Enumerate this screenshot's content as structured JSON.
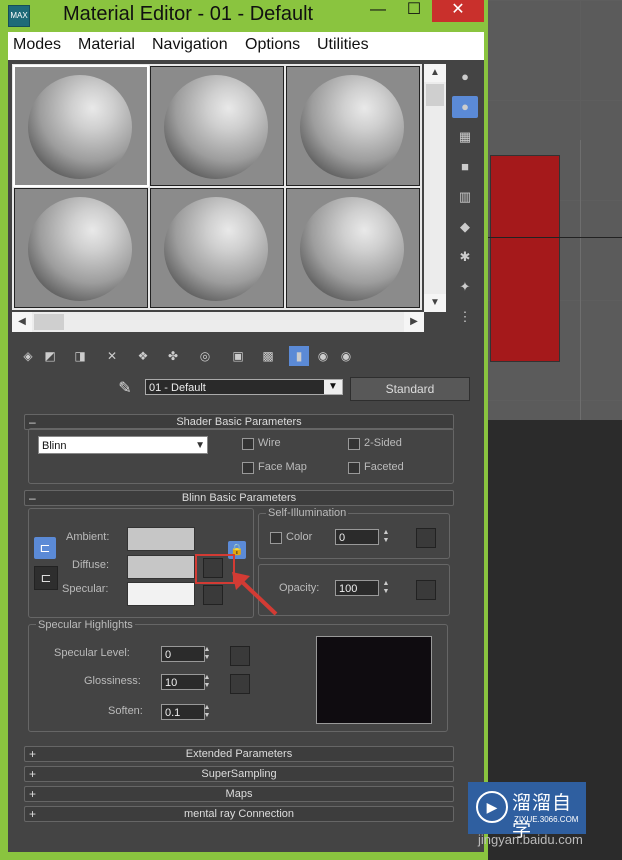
{
  "window": {
    "title": "Material Editor - 01 - Default",
    "app_icon_label": "MAX",
    "min_glyph": "—",
    "max_glyph": "☐",
    "close_glyph": "✕",
    "frame_color": "#8ac43f"
  },
  "menu": {
    "items": [
      {
        "label": "Modes"
      },
      {
        "label": "Material"
      },
      {
        "label": "Navigation"
      },
      {
        "label": "Options"
      },
      {
        "label": "Utilities"
      }
    ]
  },
  "sample_slots": {
    "count": 6,
    "selected_index": 0
  },
  "material": {
    "name": "01 - Default",
    "type": "Standard"
  },
  "shader_basic_parameters": {
    "header": "Shader Basic Parameters",
    "shader": "Blinn",
    "wire_label": "Wire",
    "two_sided_label": "2-Sided",
    "face_map_label": "Face Map",
    "faceted_label": "Faceted"
  },
  "blinn_basic_parameters": {
    "header": "Blinn Basic Parameters",
    "ambient_label": "Ambient:",
    "diffuse_label": "Diffuse:",
    "specular_label": "Specular:",
    "ambient_color": "#c6c6c6",
    "diffuse_color": "#c6c6c6",
    "specular_color": "#f2f2f2",
    "self_illumination_label": "Self-Illumination",
    "color_label": "Color",
    "self_illum_value": "0",
    "opacity_label": "Opacity:",
    "opacity_value": "100",
    "specular_highlights_label": "Specular Highlights",
    "specular_level_label": "Specular Level:",
    "specular_level_value": "0",
    "glossiness_label": "Glossiness:",
    "glossiness_value": "10",
    "soften_label": "Soften:",
    "soften_value": "0.1"
  },
  "collapsed_rollouts": [
    {
      "label": "Extended Parameters"
    },
    {
      "label": "SuperSampling"
    },
    {
      "label": "Maps"
    },
    {
      "label": "mental ray Connection"
    }
  ],
  "watermark": {
    "name": "溜溜自学",
    "url": "ZIXUE.3066.COM",
    "baidu": "jingyan.baidu.com"
  },
  "colors": {
    "highlight_red": "#d33b34",
    "active_blue": "#5b8ad6"
  }
}
